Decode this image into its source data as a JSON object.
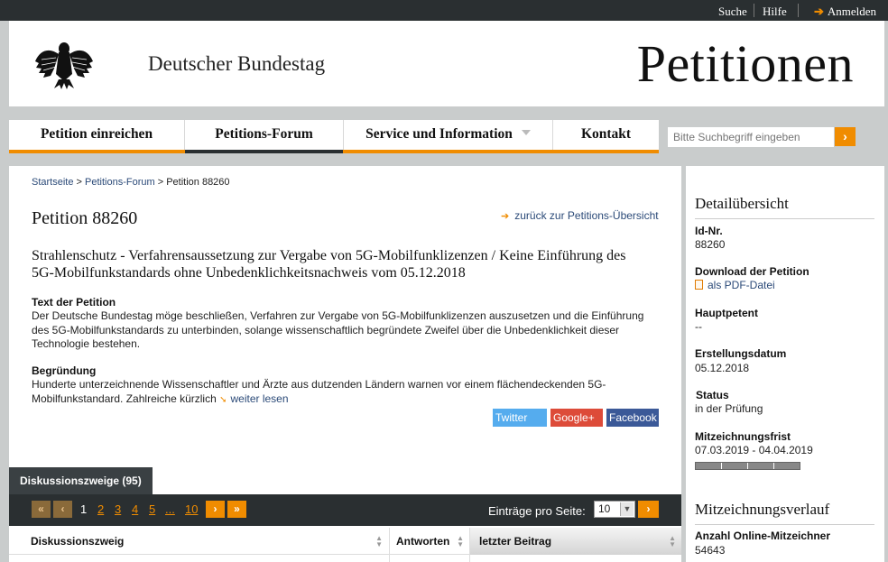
{
  "topbar": {
    "search": "Suche",
    "help": "Hilfe",
    "login": "Anmelden"
  },
  "header": {
    "institution": "Deutscher Bundestag",
    "site_title": "Petitionen"
  },
  "nav": {
    "items": [
      {
        "label": "Petition einreichen"
      },
      {
        "label": "Petitions-Forum"
      },
      {
        "label": "Service und Information"
      },
      {
        "label": "Kontakt"
      }
    ],
    "search_placeholder": "Bitte Suchbegriff eingeben",
    "search_go": "›"
  },
  "breadcrumb": {
    "home": "Startseite",
    "forum": "Petitions-Forum",
    "current": "Petition 88260"
  },
  "petition": {
    "title": "Petition 88260",
    "back_link": "zurück zur Petitions-Übersicht",
    "subject": "Strahlenschutz - Verfahrensaussetzung zur Vergabe von 5G-Mobilfunklizenzen / Keine Einführung des 5G-Mobilfunkstandards ohne Unbedenklichkeitsnachweis vom 05.12.2018",
    "text_heading": "Text der Petition",
    "text_body": "Der Deutsche Bundestag möge beschließen, Verfahren zur Vergabe von 5G-Mobilfunklizenzen auszusetzen und die Einführung des 5G-Mobilfunkstandards zu unterbinden, solange wissenschaftlich begründete Zweifel über die Unbedenklichkeit dieser Technologie bestehen.",
    "reason_heading": "Begründung",
    "reason_body": "Hunderte unterzeichnende Wissenschaftler und Ärzte aus dutzenden Ländern warnen vor einem flächendeckenden 5G-Mobilfunkstandard. Zahlreiche kürzlich",
    "read_more": "weiter lesen"
  },
  "share": {
    "twitter": "Twitter",
    "google": "Google+",
    "facebook": "Facebook"
  },
  "discussion": {
    "tab_label": "Diskussionszweige (95)",
    "pager": {
      "first": "«",
      "prev": "‹",
      "pages": [
        "1",
        "2",
        "3",
        "4",
        "5",
        "...",
        "10"
      ],
      "current_page": "1",
      "next": "›",
      "last": "»",
      "per_page_label": "Einträge pro Seite:",
      "per_page_value": "10",
      "go": "›"
    },
    "columns": [
      "Diskussionszweig",
      "Antworten",
      "letzter Beitrag"
    ]
  },
  "sidebar": {
    "detail_heading": "Detailübersicht",
    "id_label": "Id-Nr.",
    "id_value": "88260",
    "download_label": "Download der Petition",
    "download_link": "als PDF-Datei",
    "main_petitioner_label": "Hauptpetent",
    "main_petitioner_value": "--",
    "created_label": "Erstellungsdatum",
    "created_value": "05.12.2018",
    "status_label": "Status",
    "status_value": "in der Prüfung",
    "signing_label": "Mitzeichnungsfrist",
    "signing_value": "07.03.2019 - 04.04.2019",
    "signing_progress": 1.0,
    "history_heading": "Mitzeichnungsverlauf",
    "online_label": "Anzahl Online-Mitzeichner",
    "online_value": "54643"
  },
  "colors": {
    "accent": "#f08c00",
    "dark": "#2a2f31",
    "link": "#2b4a78"
  }
}
